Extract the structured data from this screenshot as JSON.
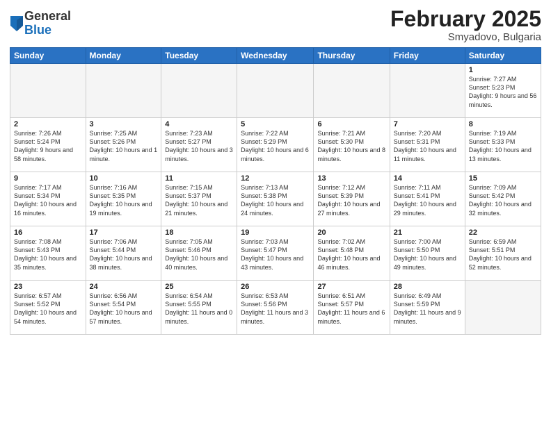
{
  "header": {
    "logo_general": "General",
    "logo_blue": "Blue",
    "main_title": "February 2025",
    "subtitle": "Smyadovo, Bulgaria"
  },
  "days_of_week": [
    "Sunday",
    "Monday",
    "Tuesday",
    "Wednesday",
    "Thursday",
    "Friday",
    "Saturday"
  ],
  "weeks": [
    [
      {
        "day": "",
        "info": ""
      },
      {
        "day": "",
        "info": ""
      },
      {
        "day": "",
        "info": ""
      },
      {
        "day": "",
        "info": ""
      },
      {
        "day": "",
        "info": ""
      },
      {
        "day": "",
        "info": ""
      },
      {
        "day": "1",
        "info": "Sunrise: 7:27 AM\nSunset: 5:23 PM\nDaylight: 9 hours and 56 minutes."
      }
    ],
    [
      {
        "day": "2",
        "info": "Sunrise: 7:26 AM\nSunset: 5:24 PM\nDaylight: 9 hours and 58 minutes."
      },
      {
        "day": "3",
        "info": "Sunrise: 7:25 AM\nSunset: 5:26 PM\nDaylight: 10 hours and 1 minute."
      },
      {
        "day": "4",
        "info": "Sunrise: 7:23 AM\nSunset: 5:27 PM\nDaylight: 10 hours and 3 minutes."
      },
      {
        "day": "5",
        "info": "Sunrise: 7:22 AM\nSunset: 5:29 PM\nDaylight: 10 hours and 6 minutes."
      },
      {
        "day": "6",
        "info": "Sunrise: 7:21 AM\nSunset: 5:30 PM\nDaylight: 10 hours and 8 minutes."
      },
      {
        "day": "7",
        "info": "Sunrise: 7:20 AM\nSunset: 5:31 PM\nDaylight: 10 hours and 11 minutes."
      },
      {
        "day": "8",
        "info": "Sunrise: 7:19 AM\nSunset: 5:33 PM\nDaylight: 10 hours and 13 minutes."
      }
    ],
    [
      {
        "day": "9",
        "info": "Sunrise: 7:17 AM\nSunset: 5:34 PM\nDaylight: 10 hours and 16 minutes."
      },
      {
        "day": "10",
        "info": "Sunrise: 7:16 AM\nSunset: 5:35 PM\nDaylight: 10 hours and 19 minutes."
      },
      {
        "day": "11",
        "info": "Sunrise: 7:15 AM\nSunset: 5:37 PM\nDaylight: 10 hours and 21 minutes."
      },
      {
        "day": "12",
        "info": "Sunrise: 7:13 AM\nSunset: 5:38 PM\nDaylight: 10 hours and 24 minutes."
      },
      {
        "day": "13",
        "info": "Sunrise: 7:12 AM\nSunset: 5:39 PM\nDaylight: 10 hours and 27 minutes."
      },
      {
        "day": "14",
        "info": "Sunrise: 7:11 AM\nSunset: 5:41 PM\nDaylight: 10 hours and 29 minutes."
      },
      {
        "day": "15",
        "info": "Sunrise: 7:09 AM\nSunset: 5:42 PM\nDaylight: 10 hours and 32 minutes."
      }
    ],
    [
      {
        "day": "16",
        "info": "Sunrise: 7:08 AM\nSunset: 5:43 PM\nDaylight: 10 hours and 35 minutes."
      },
      {
        "day": "17",
        "info": "Sunrise: 7:06 AM\nSunset: 5:44 PM\nDaylight: 10 hours and 38 minutes."
      },
      {
        "day": "18",
        "info": "Sunrise: 7:05 AM\nSunset: 5:46 PM\nDaylight: 10 hours and 40 minutes."
      },
      {
        "day": "19",
        "info": "Sunrise: 7:03 AM\nSunset: 5:47 PM\nDaylight: 10 hours and 43 minutes."
      },
      {
        "day": "20",
        "info": "Sunrise: 7:02 AM\nSunset: 5:48 PM\nDaylight: 10 hours and 46 minutes."
      },
      {
        "day": "21",
        "info": "Sunrise: 7:00 AM\nSunset: 5:50 PM\nDaylight: 10 hours and 49 minutes."
      },
      {
        "day": "22",
        "info": "Sunrise: 6:59 AM\nSunset: 5:51 PM\nDaylight: 10 hours and 52 minutes."
      }
    ],
    [
      {
        "day": "23",
        "info": "Sunrise: 6:57 AM\nSunset: 5:52 PM\nDaylight: 10 hours and 54 minutes."
      },
      {
        "day": "24",
        "info": "Sunrise: 6:56 AM\nSunset: 5:54 PM\nDaylight: 10 hours and 57 minutes."
      },
      {
        "day": "25",
        "info": "Sunrise: 6:54 AM\nSunset: 5:55 PM\nDaylight: 11 hours and 0 minutes."
      },
      {
        "day": "26",
        "info": "Sunrise: 6:53 AM\nSunset: 5:56 PM\nDaylight: 11 hours and 3 minutes."
      },
      {
        "day": "27",
        "info": "Sunrise: 6:51 AM\nSunset: 5:57 PM\nDaylight: 11 hours and 6 minutes."
      },
      {
        "day": "28",
        "info": "Sunrise: 6:49 AM\nSunset: 5:59 PM\nDaylight: 11 hours and 9 minutes."
      },
      {
        "day": "",
        "info": ""
      }
    ]
  ]
}
